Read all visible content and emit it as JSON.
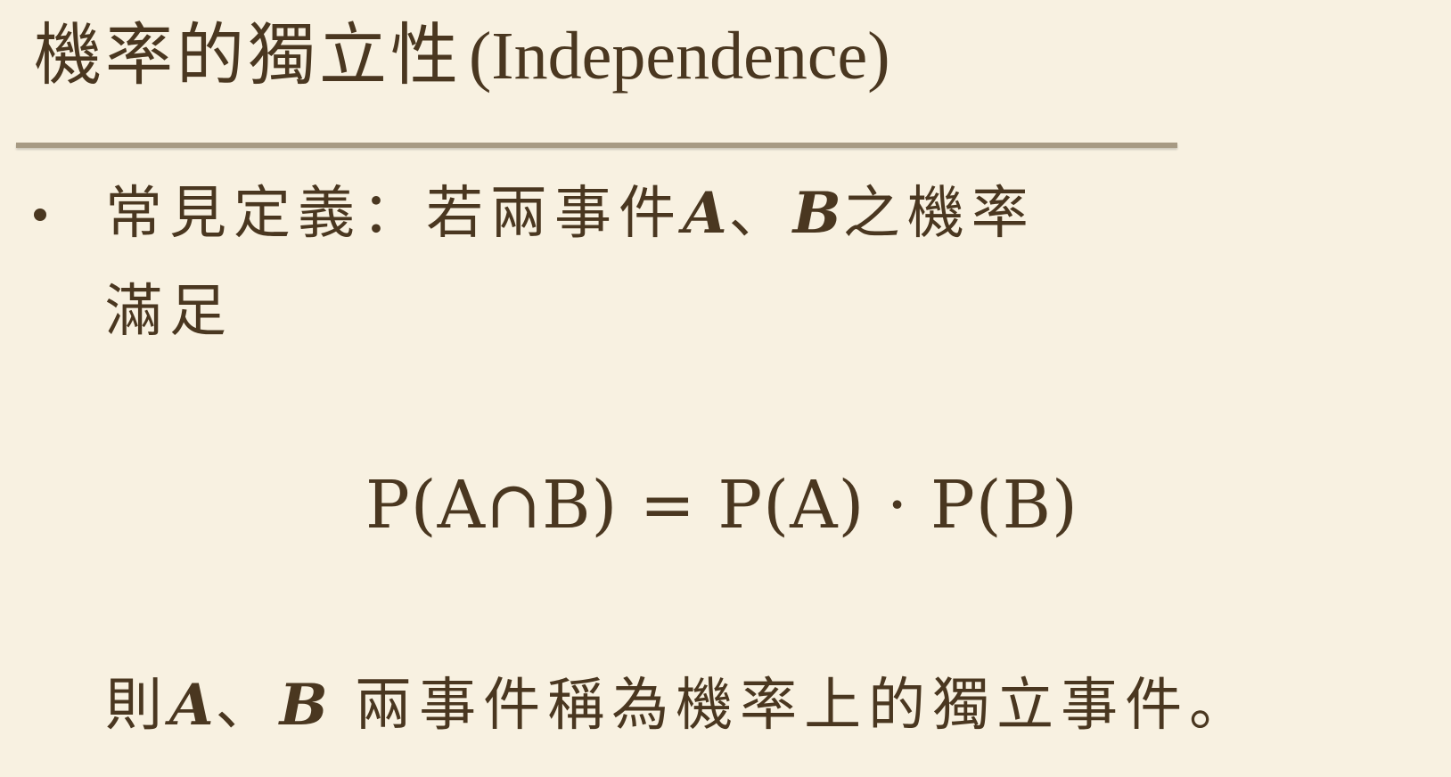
{
  "slide": {
    "title_zh": "機率的獨立性",
    "title_en": "(Independence)",
    "definition": {
      "line1_prefix": "常見定義：若兩事件",
      "var_a": "A",
      "separator": "、",
      "var_b": "B",
      "line1_suffix": "之機率",
      "line2": "滿足"
    },
    "formula": "P(A∩B) = P(A) · P(B)",
    "conclusion": {
      "prefix": "則",
      "var_a": "A",
      "separator": "、",
      "var_b": "B",
      "suffix": " 兩事件稱為機率上的獨立事件。"
    }
  }
}
